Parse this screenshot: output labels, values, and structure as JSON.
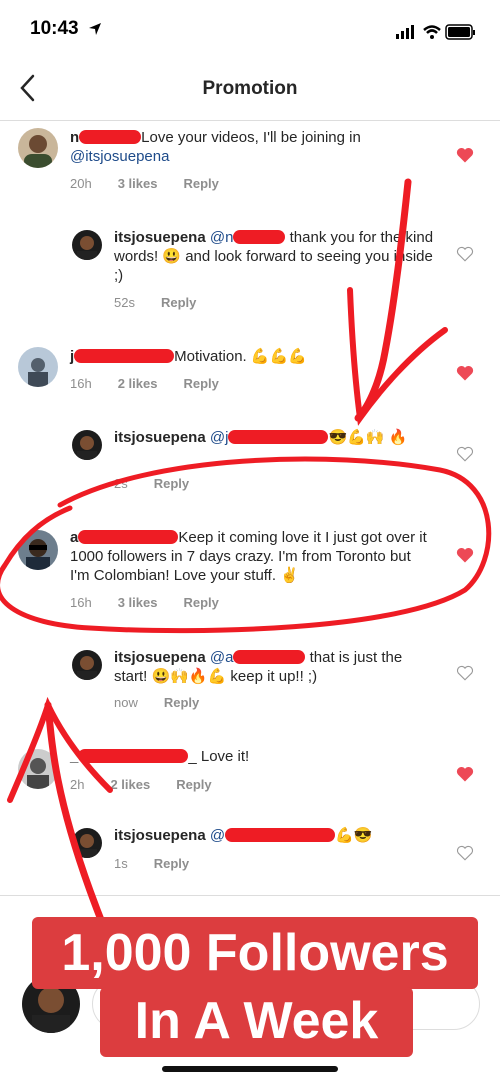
{
  "status": {
    "time": "10:43"
  },
  "nav": {
    "title": "Promotion"
  },
  "comments": [
    {
      "user": "n",
      "text": "Love your videos, I'll be joining in",
      "mention": "@itsjosuepena",
      "time": "20h",
      "likes": "3 likes",
      "reply": "Reply",
      "liked": true
    },
    {
      "user": "itsjosuepena",
      "mention": "@n",
      "text": "thank you for the kind words! 😃 and look forward to seeing you inside ;)",
      "time": "52s",
      "reply": "Reply",
      "liked": false
    },
    {
      "user": "j",
      "text": "Motivation. 💪💪💪",
      "time": "16h",
      "likes": "2 likes",
      "reply": "Reply",
      "liked": true
    },
    {
      "user": "itsjosuepena",
      "mention": "@j",
      "text": "😎💪🙌 🔥",
      "time": "2s",
      "reply": "Reply",
      "liked": false
    },
    {
      "user": "a",
      "text": "Keep it coming love it I just got over it 1000 followers in 7 days crazy. I'm from Toronto but I'm Colombian! Love your stuff. ✌️",
      "time": "16h",
      "likes": "3 likes",
      "reply": "Reply",
      "liked": true
    },
    {
      "user": "itsjosuepena",
      "mention": "@a",
      "text": "that is just the start! 😃🙌🔥💪 keep it up!! ;)",
      "time": "now",
      "reply": "Reply",
      "liked": false
    },
    {
      "user": "_",
      "text": "_ Love it!",
      "time": "2h",
      "likes": "2 likes",
      "reply": "Reply",
      "liked": true
    },
    {
      "user": "itsjosuepena",
      "mention": "@",
      "text": "💪😎",
      "time": "1s",
      "reply": "Reply",
      "liked": false
    }
  ],
  "overlay": {
    "line1": "1,000 Followers",
    "line2": "In A Week"
  },
  "colors": {
    "heart_liked": "#ed4956",
    "annotation": "#ee1c24",
    "banner": "#dc3d3f",
    "mention": "#1e4b8a"
  }
}
